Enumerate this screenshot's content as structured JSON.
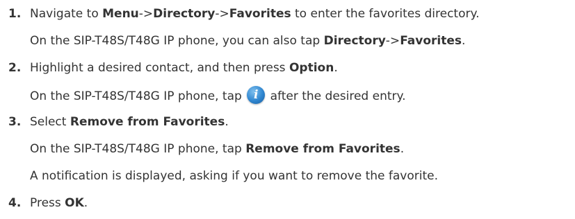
{
  "steps": [
    {
      "number": "1.",
      "line1": {
        "p1": "Navigate to ",
        "b1": "Menu",
        "p2": "->",
        "b2": "Directory",
        "p3": "->",
        "b3": "Favorites",
        "p4": " to enter the favorites directory."
      },
      "line2": {
        "p1": "On the SIP-T48S/T48G IP phone, you can also tap ",
        "b1": "Directory",
        "p2": "->",
        "b2": "Favorites",
        "p3": "."
      }
    },
    {
      "number": "2.",
      "line1": {
        "p1": "Highlight a desired contact, and then press ",
        "b1": "Option",
        "p2": "."
      },
      "line2": {
        "p1": "On the SIP-T48S/T48G IP phone, tap ",
        "icon": "info-icon",
        "icon_glyph": "i",
        "p2": " after the desired entry."
      }
    },
    {
      "number": "3.",
      "line1": {
        "p1": "Select ",
        "b1": "Remove from Favorites",
        "p2": "."
      },
      "line2": {
        "p1": "On the SIP-T48S/T48G IP phone, tap ",
        "b1": "Remove from Favorites",
        "p2": "."
      },
      "line3": {
        "p1": "A notification is displayed, asking if you want to remove the favorite."
      }
    },
    {
      "number": "4.",
      "line1": {
        "p1": "Press ",
        "b1": "OK",
        "p2": "."
      }
    }
  ]
}
